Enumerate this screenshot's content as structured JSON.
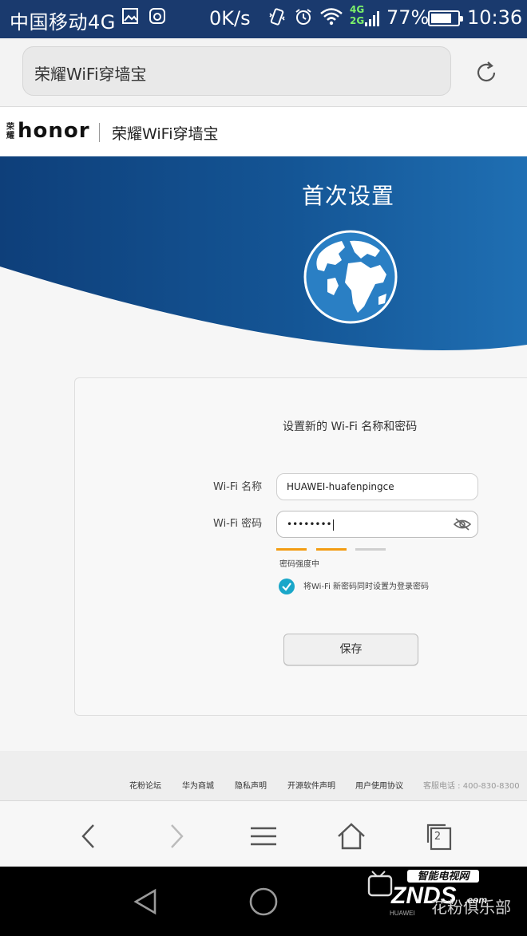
{
  "status_bar": {
    "carrier": "中国移动4G",
    "net_speed": "0K/s",
    "network_types": [
      "4G",
      "2G"
    ],
    "battery_percent": "77%",
    "battery_level": 0.77,
    "time": "10:36"
  },
  "address_bar": {
    "url": "荣耀WiFi穿墙宝",
    "reload_icon": "reload-icon"
  },
  "site_header": {
    "logo_cn": "荣耀",
    "logo_text": "honor",
    "title": "荣耀WiFi穿墙宝"
  },
  "hero": {
    "title": "首次设置",
    "colors": {
      "dark": "#0e3f7a",
      "light": "#1f6fb3"
    },
    "icon": "globe-icon"
  },
  "form": {
    "heading": "设置新的 Wi-Fi 名称和密码",
    "wifi_name_label": "Wi-Fi 名称",
    "wifi_name_value": "HUAWEI-huafenpingce",
    "wifi_password_label": "Wi-Fi 密码",
    "wifi_password_value": "••••••••",
    "password_visibility_icon": "eye-off-icon",
    "strength_levels_filled": 2,
    "strength_levels_total": 3,
    "strength_color": "#f39c12",
    "strength_text": "密码强度中",
    "sync_login_checked": true,
    "sync_login_label": "将Wi-Fi 新密码同时设置为登录密码",
    "check_color": "#1aa7c9",
    "save_label": "保存"
  },
  "footer": {
    "links": [
      "花粉论坛",
      "华为商城",
      "隐私声明",
      "开源软件声明",
      "用户使用协议"
    ],
    "hotline": "客服电话 : 400-830-8300"
  },
  "browser_toolbar": {
    "icons": [
      "back-icon",
      "forward-icon",
      "menu-icon",
      "home-icon",
      "tabs-icon"
    ],
    "tab_count": "2"
  },
  "nav_bar": {
    "icons": [
      "nav-back-icon",
      "nav-home-icon"
    ]
  },
  "watermark": {
    "brand": "智能电视网",
    "logo": "ZNDS",
    "logo_suffix": ".com",
    "maker": "HUAWEI",
    "text": "花粉俱乐部"
  }
}
